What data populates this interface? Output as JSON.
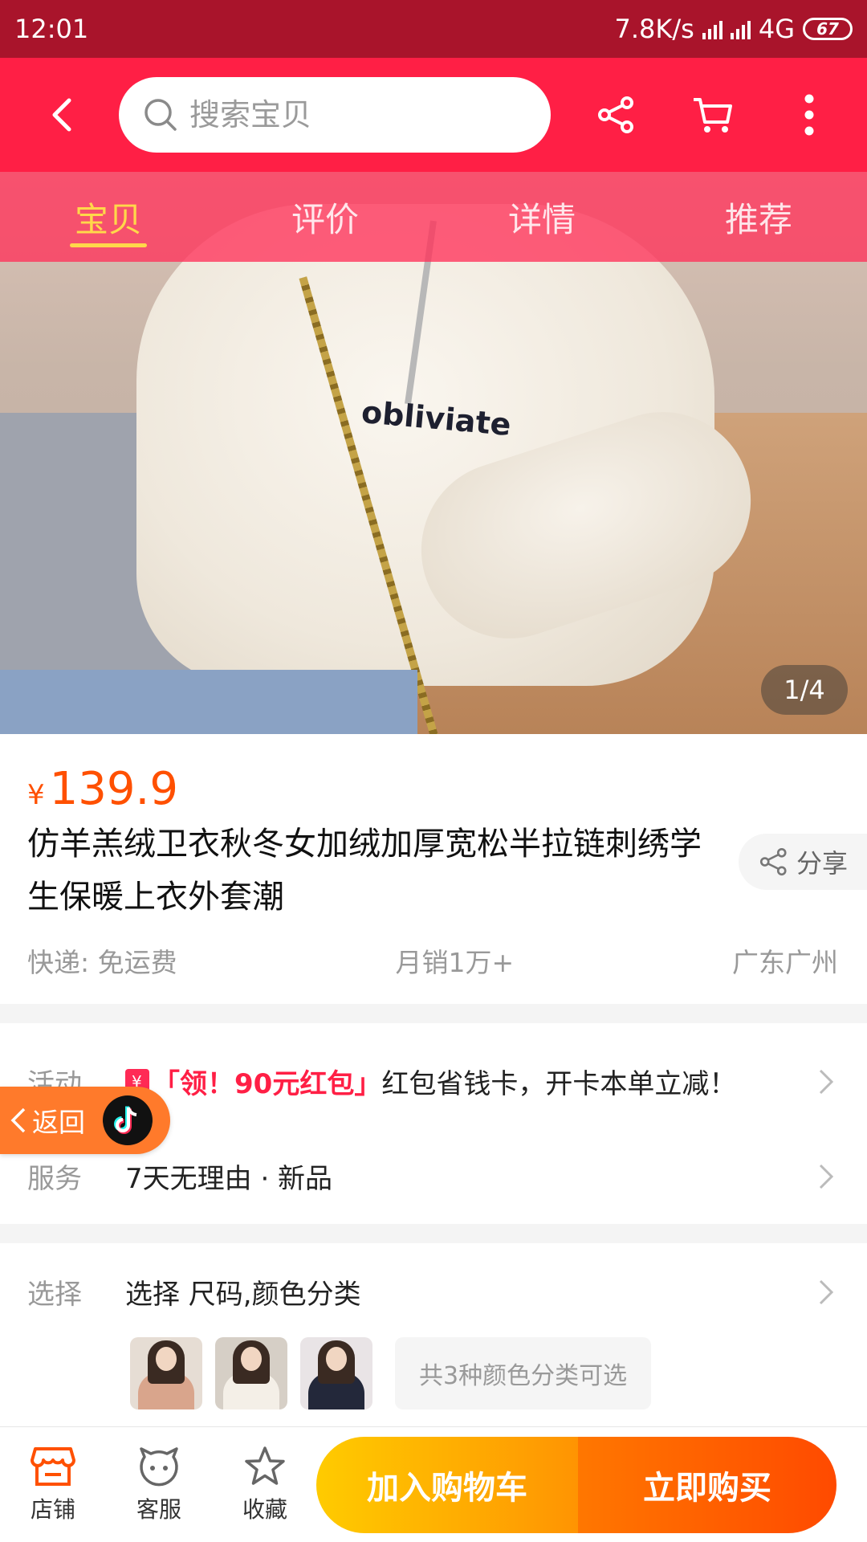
{
  "status_bar": {
    "time": "12:01",
    "network_speed": "7.8K/s",
    "network_type": "4G",
    "battery": "67"
  },
  "header": {
    "search_placeholder": "搜索宝贝"
  },
  "section_tabs": [
    {
      "label": "宝贝",
      "active": true
    },
    {
      "label": "评价",
      "active": false
    },
    {
      "label": "详情",
      "active": false
    },
    {
      "label": "推荐",
      "active": false
    }
  ],
  "hero": {
    "logo_text": "obliviate",
    "page_indicator": "1/4"
  },
  "product": {
    "currency_symbol": "¥",
    "price": "139.9",
    "title": "仿羊羔绒卫衣秋冬女加绒加厚宽松半拉链刺绣学生保暖上衣外套潮",
    "share_label": "分享",
    "shipping": "快递: 免运费",
    "monthly_sales": "月销1万+",
    "location": "广东广州"
  },
  "promotion": {
    "label": "活动",
    "coupon_text": "「领！90元红包」",
    "description": "红包省钱卡，开卡本单立减！"
  },
  "floating_back": {
    "label": "返回"
  },
  "service": {
    "label": "服务",
    "items": "7天无理由 · 新品"
  },
  "selection": {
    "label": "选择",
    "text": "选择 尺码,颜色分类",
    "variant_summary": "共3种颜色分类可选",
    "thumbnails": [
      {
        "name": "pink",
        "color": "#d9a58c"
      },
      {
        "name": "white",
        "color": "#ece6dc"
      },
      {
        "name": "navy",
        "color": "#23283a"
      }
    ]
  },
  "bottom_bar": {
    "store_label": "店铺",
    "service_label": "客服",
    "favorite_label": "收藏",
    "add_to_cart": "加入购物车",
    "buy_now": "立即购买"
  },
  "colors": {
    "brand_red": "#ff1f45",
    "price_orange": "#ff5000",
    "active_tab": "#ffd84a"
  }
}
